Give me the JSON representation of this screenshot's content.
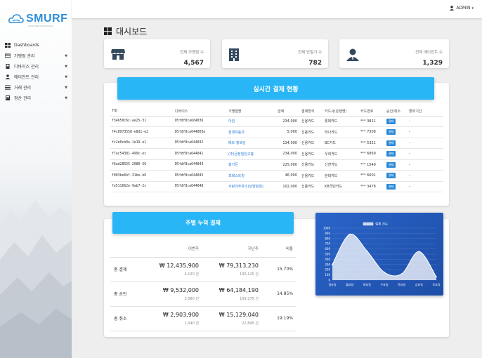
{
  "brand": {
    "name": "SMURF",
    "tagline": "Smart Merchant Fintech",
    "color": "#2d8fd8"
  },
  "sidebar": {
    "items": [
      {
        "label": "Dashboards",
        "icon": "grid-icon",
        "chevron": false
      },
      {
        "label": "가맹점 관리",
        "icon": "card-icon",
        "chevron": true
      },
      {
        "label": "디바이스 관리",
        "icon": "device-icon",
        "chevron": true
      },
      {
        "label": "에이전트 관리",
        "icon": "person-icon",
        "chevron": true
      },
      {
        "label": "거래 관리",
        "icon": "list-icon",
        "chevron": true
      },
      {
        "label": "정산 관리",
        "icon": "calc-icon",
        "chevron": true
      }
    ]
  },
  "topbar": {
    "user": "ADMIN",
    "caret": "▾"
  },
  "page": {
    "title": "대시보드"
  },
  "stats": [
    {
      "label": "전체 가맹점 수",
      "value": "4,567",
      "icon": "store-icon"
    },
    {
      "label": "전체 단말기 수",
      "value": "782",
      "icon": "building-icon"
    },
    {
      "label": "전체 에이전트 수",
      "value": "1,329",
      "icon": "agent-icon"
    }
  ],
  "realtime": {
    "title": "실시간 결제 현황",
    "columns": [
      "TID",
      "디바이스",
      "가맹점명",
      "금액",
      "결제방식",
      "카드사(은행명)",
      "카드번호",
      "승인/취소",
      "할부기간"
    ],
    "rows": [
      [
        "f34650c6c-ae25-31",
        "D5fdf8ca6d4836",
        "아임",
        "234,000",
        "신용카드",
        "롯데카드",
        "*** 3811",
        "결제",
        "-"
      ],
      [
        "f4c8973558-e8d1-e2",
        "D5fdf8ca644803e",
        "현대자동차",
        "5,000",
        "신용카드",
        "하나카드",
        "*** 7308",
        "결제",
        "-"
      ],
      [
        "fc2e0cb0e-1e19-e1",
        "D5fdf8ca644832",
        "메트 행복당",
        "134,000",
        "신용카드",
        "BC카드",
        "*** 5321",
        "결제",
        "-"
      ],
      [
        "f7ac54381-499c-ec",
        "D5fdf8ca644841",
        "(주)금정빌딩고흥",
        "234,000",
        "신용카드",
        "우리카드",
        "*** 6869",
        "결제",
        "-"
      ],
      [
        "f6ad28555-2080-56",
        "D5fdf8ca644843",
        "홈가든",
        "225,000",
        "신용카드",
        "신한카드",
        "*** 1549",
        "결제",
        "-"
      ],
      [
        "f003be6bf-31be-b6",
        "D5fdf8ca644845",
        "포레스트힐",
        "46,000",
        "신용카드",
        "현대카드",
        "*** 6601",
        "결제",
        "-"
      ],
      [
        "fe511662e-9ab7-2c",
        "D5fdf8ca644848",
        "사랑의주유소(남양분점)",
        "102,000",
        "신용카드",
        "KB국민카드",
        "*** 3478",
        "결제",
        "-"
      ]
    ]
  },
  "weekly": {
    "title": "주별 누적 결제",
    "columns": [
      "",
      "이번주",
      "지난주",
      "비율"
    ],
    "rows": [
      {
        "label": "총 결제",
        "this_amount": "₩ 12,435,900",
        "this_count": "4,120 건",
        "last_amount": "₩ 79,313,230",
        "last_count": "130,120 건",
        "ratio": "15.70%"
      },
      {
        "label": "총 승인",
        "this_amount": "₩ 9,532,000",
        "this_count": "3,080 건",
        "last_amount": "₩ 64,184,190",
        "last_count": "109,275 건",
        "ratio": "14.85%"
      },
      {
        "label": "총 취소",
        "this_amount": "₩ 2,903,900",
        "this_count": "1,040 건",
        "last_amount": "₩ 15,129,040",
        "last_count": "22,845 건",
        "ratio": "19.19%"
      }
    ]
  },
  "chart_data": {
    "type": "area",
    "legend": "결제 건수",
    "categories": [
      "일요일",
      "월요일",
      "화요일",
      "수요일",
      "목요일",
      "금요일",
      "토요일"
    ],
    "values": [
      300,
      880,
      560,
      150,
      120,
      550,
      60
    ],
    "ylim": [
      0,
      1000
    ],
    "yticks": [
      0,
      100,
      200,
      300,
      400,
      500,
      600,
      700,
      800,
      900,
      1000
    ],
    "colors": {
      "fill": "#ffffff",
      "background": "#2a64c9"
    }
  }
}
